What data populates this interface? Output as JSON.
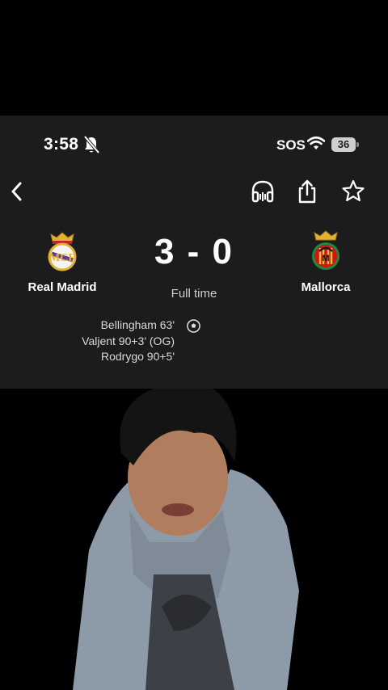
{
  "status_bar": {
    "time": "3:58",
    "carrier": "SOS",
    "battery": "36",
    "icons": [
      "bell-slash-icon",
      "wifi-icon",
      "battery-icon"
    ]
  },
  "nav": {
    "icons": [
      "back-chevron-icon",
      "headphones-icon",
      "share-icon",
      "star-icon"
    ]
  },
  "match": {
    "home_team": "Real Madrid",
    "away_team": "Mallorca",
    "score": "3 - 0",
    "status": "Full time",
    "scorers": [
      "Bellingham 63'",
      "Valjent 90+3' (OG)",
      "Rodrygo 90+5'"
    ],
    "goal_icon": "soccer-ball-icon"
  },
  "colors": {
    "card_bg": "#1c1c1e",
    "text": "#ffffff",
    "secondary_text": "#cfcfcf",
    "madrid_gold": "#e1b131",
    "mallorca_red": "#d4121b"
  }
}
